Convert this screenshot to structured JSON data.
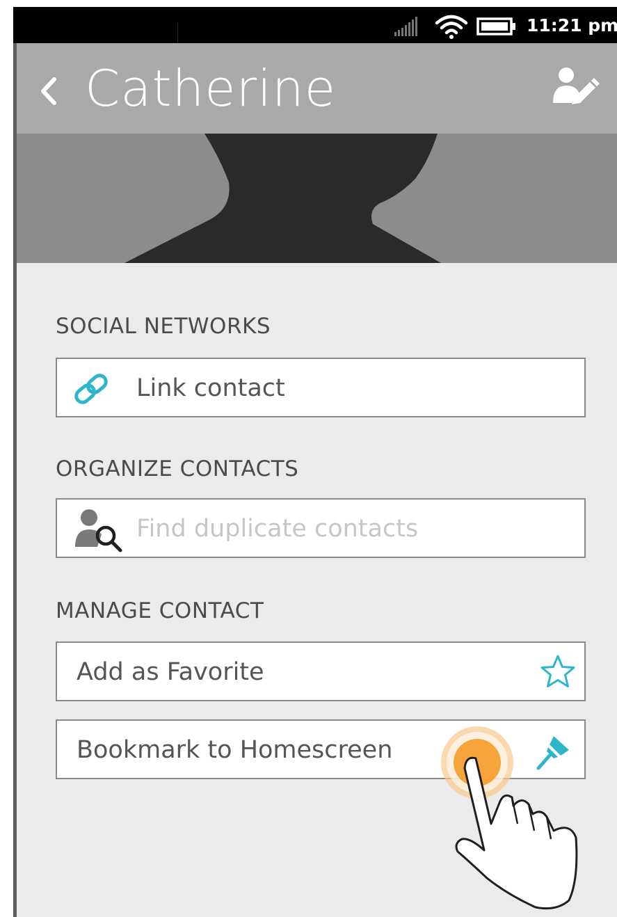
{
  "status_bar": {
    "time": "11:21 pm",
    "icons": [
      "signal-icon",
      "wifi-icon",
      "battery-icon"
    ]
  },
  "header": {
    "title": "Catherine",
    "back_icon": "chevron-left-icon",
    "edit_icon": "edit-contact-icon"
  },
  "photo": {
    "icon": "person-silhouette"
  },
  "sections": [
    {
      "title": "SOCIAL NETWORKS",
      "items": [
        {
          "label": "Link contact",
          "icon": "link-icon",
          "enabled": true
        }
      ]
    },
    {
      "title": "ORGANIZE CONTACTS",
      "items": [
        {
          "label": "Find duplicate contacts",
          "icon": "find-person-icon",
          "enabled": false
        }
      ]
    },
    {
      "title": "MANAGE CONTACT",
      "items": [
        {
          "label": "Add as Favorite",
          "icon": "star-icon",
          "enabled": true
        },
        {
          "label": "Bookmark to Homescreen",
          "icon": "pin-icon",
          "enabled": true
        }
      ]
    }
  ],
  "overlay": {
    "icon": "touch-hand-icon"
  },
  "colors": {
    "status_bar": "#000000",
    "header": "#a8a9a8",
    "content_bg": "#ebebec",
    "accent": "#2fb5c9",
    "touch": "#f7a43a"
  }
}
